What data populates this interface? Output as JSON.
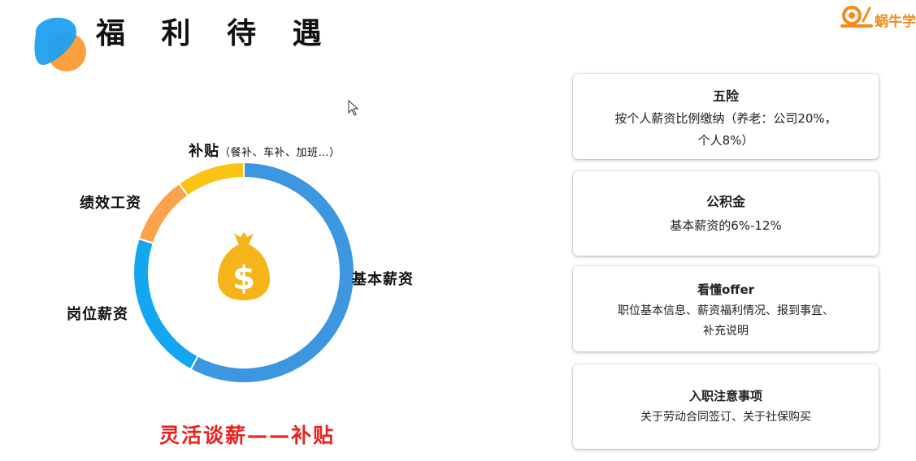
{
  "header": {
    "title": "福 利 待 遇",
    "brand_text": "蜗牛学"
  },
  "chart_data": {
    "type": "donut",
    "categories": [
      "基本薪资",
      "岗位薪资",
      "绩效工资",
      "补贴"
    ],
    "values": [
      58,
      22,
      10,
      10
    ],
    "colors": [
      "#3c97e0",
      "#13a7f1",
      "#fba24a",
      "#fbc315"
    ],
    "center_icon": "money-bag-icon",
    "labels": {
      "base_salary": "基本薪资",
      "position_salary": "岗位薪资",
      "performance_pay": "绩效工资",
      "allowance": "补贴",
      "allowance_note": "（餐补、车补、加班…）"
    }
  },
  "caption": "灵活谈薪——补贴",
  "cards": [
    {
      "title": "五险",
      "body": [
        "按个人薪资比例缴纳（养老：公司20%，",
        "个人8%）"
      ]
    },
    {
      "title": "公积金",
      "body": [
        "基本薪资的6%-12%"
      ]
    },
    {
      "title": "看懂offer",
      "body": [
        "职位基本信息、薪资福利情况、报到事宜、",
        "补充说明"
      ]
    },
    {
      "title": "入职注意事项",
      "body": [
        "关于劳动合同签订、关于社保购买"
      ]
    }
  ]
}
